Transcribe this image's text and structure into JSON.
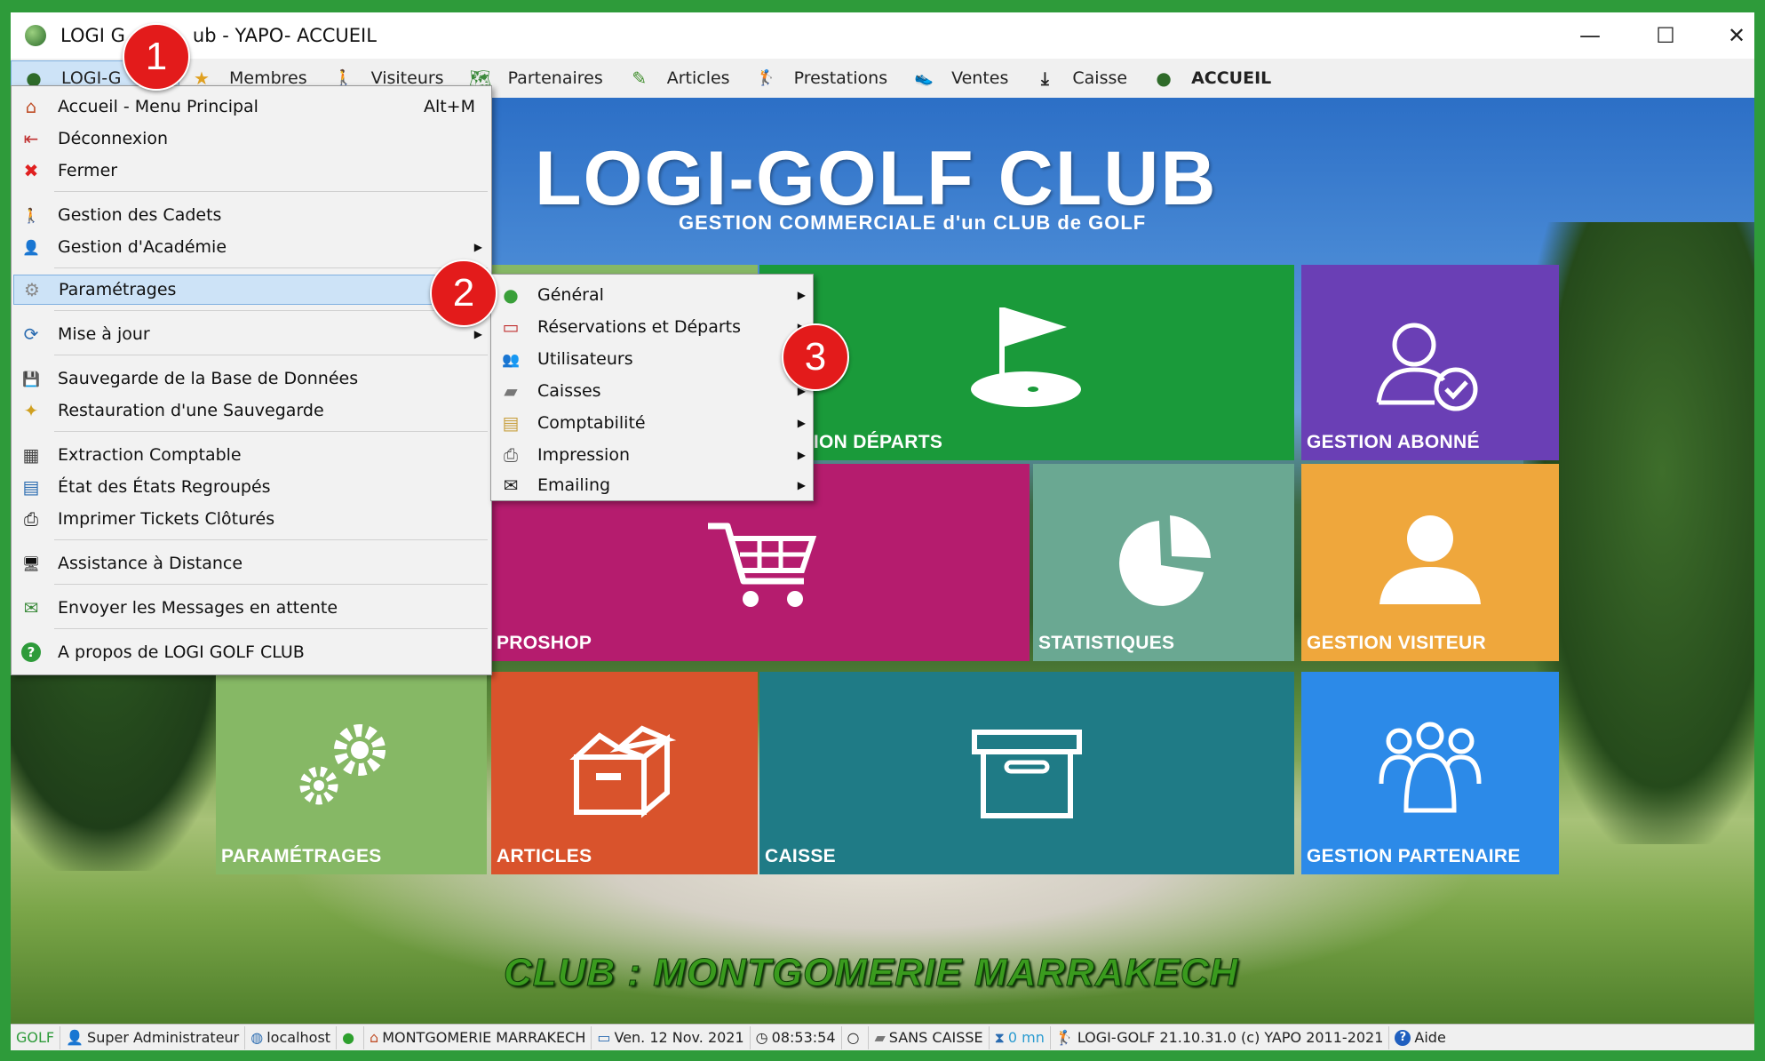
{
  "window": {
    "title": "LOGI GOLF Club - YAPO- ACCUEIL",
    "title_visible_prefix": "LOGI G",
    "title_visible_suffix": "ub - YAPO- ACCUEIL",
    "minimize": "—",
    "maximize": "☐",
    "close": "✕"
  },
  "menubar": {
    "items": [
      {
        "label": "LOGI-G",
        "icon": "golf-ball-icon",
        "glyph": "●"
      },
      {
        "label": "Membres",
        "icon": "star-icon",
        "glyph": "★"
      },
      {
        "label": "Visiteurs",
        "icon": "walker-icon",
        "glyph": "🚶"
      },
      {
        "label": "Partenaires",
        "icon": "map-icon",
        "glyph": "🗺"
      },
      {
        "label": "Articles",
        "icon": "pen-icon",
        "glyph": "✎"
      },
      {
        "label": "Prestations",
        "icon": "golfer-icon",
        "glyph": "🏌"
      },
      {
        "label": "Ventes",
        "icon": "shoe-icon",
        "glyph": "👟"
      },
      {
        "label": "Caisse",
        "icon": "download-icon",
        "glyph": "⤓"
      },
      {
        "label": "ACCUEIL",
        "icon": "golf-ball-icon",
        "glyph": "●"
      }
    ]
  },
  "brand": {
    "title": "LOGI-GOLF CLUB",
    "subtitle": "GESTION COMMERCIALE d'un CLUB de GOLF"
  },
  "tiles": {
    "reservation": "RVATION DÉPARTS",
    "abonne": "GESTION ABONNÉ",
    "proshop": "PROSHOP",
    "statistiques": "STATISTIQUES",
    "visiteur": "GESTION VISITEUR",
    "parametrages": "PARAMÉTRAGES",
    "articles": "ARTICLES",
    "caisse": "CAISSE",
    "partenaire": "GESTION PARTENAIRE"
  },
  "colors": {
    "green_tile": "#1a9a3a",
    "purple_tile": "#6a3fb5",
    "magenta_tile": "#b51c6e",
    "teal_light_tile": "#6aa892",
    "orange_tile": "#efa73c",
    "lightgreen_tile": "#86b865",
    "red_orange_tile": "#d9532c",
    "teal_tile": "#1f7b86",
    "blue_tile": "#2c8ae8",
    "badge": "#e31b1b"
  },
  "club_footer": "CLUB : MONTGOMERIE MARRAKECH",
  "main_menu": {
    "items": [
      {
        "label": "Accueil - Menu Principal",
        "shortcut": "Alt+M",
        "icon": "home-icon",
        "glyph": "⌂"
      },
      {
        "label": "Déconnexion",
        "icon": "logout-icon",
        "glyph": "⇤"
      },
      {
        "label": "Fermer",
        "icon": "close-icon",
        "glyph": "✖"
      },
      {
        "label": "Gestion des Cadets",
        "icon": "walker-icon",
        "glyph": "🚶"
      },
      {
        "label": "Gestion d'Académie",
        "icon": "user-icon",
        "glyph": "👤"
      },
      {
        "label": "Paramétrages",
        "icon": "settings-icon",
        "glyph": "⚙"
      },
      {
        "label": "Mise à jour",
        "icon": "update-icon",
        "glyph": "⟳"
      },
      {
        "label": "Sauvegarde de la Base de Données",
        "icon": "backup-icon",
        "glyph": "💾"
      },
      {
        "label": "Restauration d'une Sauvegarde",
        "icon": "restore-icon",
        "glyph": "✦"
      },
      {
        "label": "Extraction Comptable",
        "icon": "calculator-icon",
        "glyph": "▦"
      },
      {
        "label": "État des États Regroupés",
        "icon": "report-icon",
        "glyph": "▤"
      },
      {
        "label": "Imprimer Tickets Clôturés",
        "icon": "printer-icon",
        "glyph": "⎙"
      },
      {
        "label": "Assistance à Distance",
        "icon": "remote-icon",
        "glyph": "🖥"
      },
      {
        "label": "Envoyer les Messages en attente",
        "icon": "mail-send-icon",
        "glyph": "✉"
      },
      {
        "label": "A propos de LOGI GOLF CLUB",
        "icon": "help-icon",
        "glyph": "?"
      }
    ]
  },
  "submenu": {
    "items": [
      {
        "label": "Général",
        "icon": "general-icon",
        "glyph": "●"
      },
      {
        "label": "Réservations et Départs",
        "icon": "reservation-icon",
        "glyph": "▭"
      },
      {
        "label": "Utilisateurs",
        "icon": "users-icon",
        "glyph": "👥"
      },
      {
        "label": "Caisses",
        "icon": "cashbox-icon",
        "glyph": "▰"
      },
      {
        "label": "Comptabilité",
        "icon": "accounting-icon",
        "glyph": "▤"
      },
      {
        "label": "Impression",
        "icon": "print-icon",
        "glyph": "⎙"
      },
      {
        "label": "Emailing",
        "icon": "email-icon",
        "glyph": "✉"
      }
    ]
  },
  "badges": [
    "1",
    "2",
    "3"
  ],
  "statusbar": {
    "items": [
      {
        "label": "GOLF",
        "icon": ""
      },
      {
        "label": "Super Administrateur",
        "icon": "admin-icon"
      },
      {
        "label": "localhost",
        "icon": "network-icon"
      },
      {
        "label": "",
        "icon": "status-dot-icon"
      },
      {
        "label": "MONTGOMERIE MARRAKECH",
        "icon": "building-icon"
      },
      {
        "label": "Ven. 12 Nov. 2021",
        "icon": "calendar-icon"
      },
      {
        "label": "08:53:54",
        "icon": "clock-icon"
      },
      {
        "label": "",
        "icon": "circle-icon"
      },
      {
        "label": "SANS CAISSE",
        "icon": "cash-icon"
      },
      {
        "label": "0 mn",
        "icon": "hourglass-icon"
      },
      {
        "label": "LOGI-GOLF 21.10.31.0 (c) YAPO 2011-2021",
        "icon": "golfer-icon"
      },
      {
        "label": "Aide",
        "icon": "help-icon"
      }
    ]
  }
}
